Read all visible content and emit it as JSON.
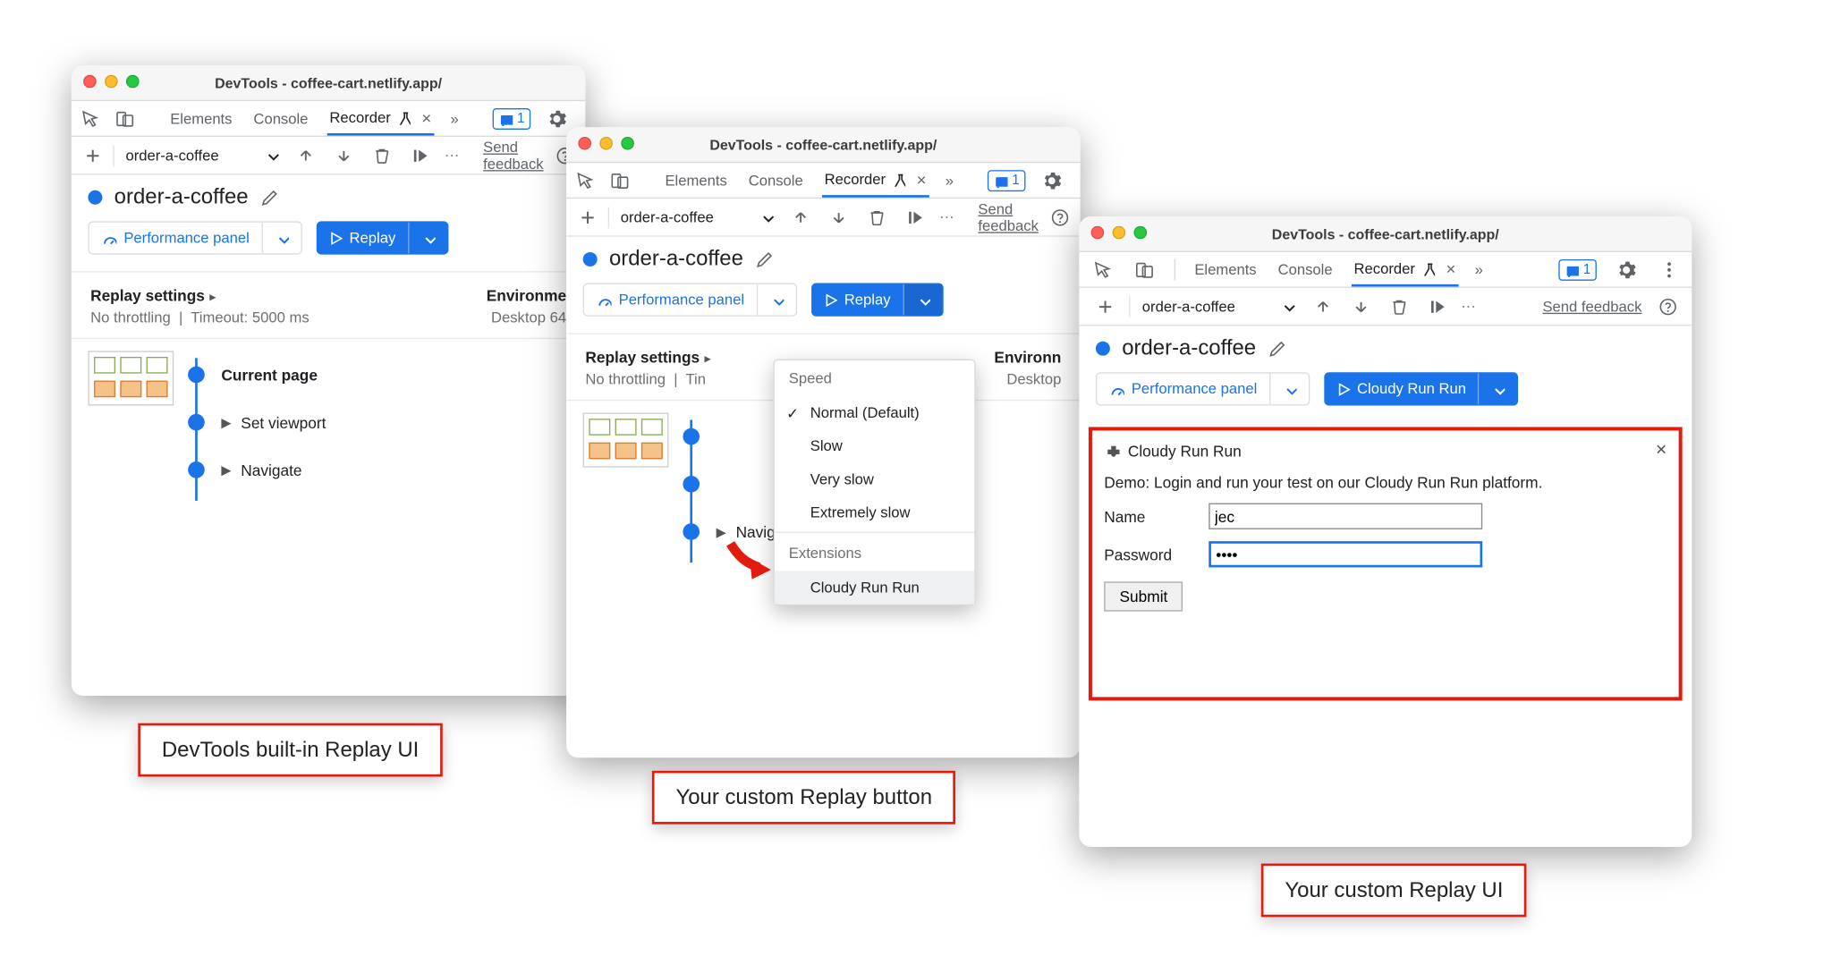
{
  "title_text": "DevTools - coffee-cart.netlify.app/",
  "tabs": {
    "elements": "Elements",
    "console": "Console",
    "recorder": "Recorder"
  },
  "messages_count": "1",
  "recording_name": "order-a-coffee",
  "feedback": "Send feedback",
  "perf_panel_label": "Performance panel",
  "replay_label": "Replay",
  "cloudy_label": "Cloudy Run Run",
  "settings_heading": "Replay settings",
  "settings_sub1": "No throttling",
  "settings_sub2": "Timeout: 5000 ms",
  "env_heading_full": "Environment",
  "env_heading_cut": "Environme",
  "env_heading_cut2": "Environn",
  "env_sub_full": "Desktop",
  "env_sub_cut": "Desktop    64",
  "steps": {
    "current": "Current page",
    "viewport": "Set viewport",
    "navigate": "Navigate"
  },
  "dropdown": {
    "speed": "Speed",
    "normal": "Normal (Default)",
    "slow": "Slow",
    "vslow": "Very slow",
    "eslow": "Extremely slow",
    "ext": "Extensions",
    "cloudy": "Cloudy Run Run"
  },
  "panel": {
    "title": "Cloudy Run Run",
    "desc": "Demo: Login and run your test on our Cloudy Run Run platform.",
    "name_label": "Name",
    "name_value": "jec",
    "pw_label": "Password",
    "pw_value": "••••",
    "submit": "Submit"
  },
  "callouts": {
    "a": "DevTools built-in Replay UI",
    "b": "Your custom Replay button",
    "c": "Your custom Replay UI"
  }
}
